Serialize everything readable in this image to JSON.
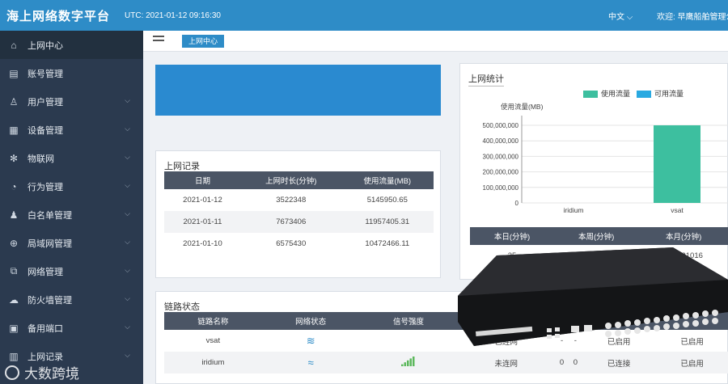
{
  "header": {
    "title": "海上网络数字平台",
    "clock": "UTC: 2021-01-12 09:16:30",
    "lang": "中文",
    "user": "欢迎: 早鹰船舶管理公"
  },
  "sidebar": {
    "items": [
      {
        "label": "上网中心",
        "icon": "home-icon",
        "active": true,
        "chevron": false
      },
      {
        "label": "账号管理",
        "icon": "id-card-icon",
        "chevron": false
      },
      {
        "label": "用户管理",
        "icon": "user-icon",
        "chevron": true
      },
      {
        "label": "设备管理",
        "icon": "device-icon",
        "chevron": true
      },
      {
        "label": "物联网",
        "icon": "iot-icon",
        "chevron": true
      },
      {
        "label": "行为管理",
        "icon": "gauge-icon",
        "chevron": true
      },
      {
        "label": "白名单管理",
        "icon": "whitelist-icon",
        "chevron": true
      },
      {
        "label": "局域网管理",
        "icon": "globe-icon",
        "chevron": true
      },
      {
        "label": "网络管理",
        "icon": "network-icon",
        "chevron": true
      },
      {
        "label": "防火墙管理",
        "icon": "cloud-icon",
        "chevron": true
      },
      {
        "label": "备用端口",
        "icon": "port-icon",
        "chevron": true
      },
      {
        "label": "上网记录",
        "icon": "record-icon",
        "chevron": true
      }
    ]
  },
  "tabs": {
    "active": "上网中心"
  },
  "records": {
    "title": "上网记录",
    "columns": [
      "日期",
      "上网时长(分钟)",
      "使用流量(MB)"
    ],
    "rows": [
      [
        "2021-01-12",
        "3522348",
        "5145950.65"
      ],
      [
        "2021-01-11",
        "7673406",
        "11957405.31"
      ],
      [
        "2021-01-10",
        "6575430",
        "10472466.11"
      ]
    ]
  },
  "traffic": {
    "title": "上网统计",
    "legend": [
      {
        "name": "使用流量",
        "color": "#3dbf9f"
      },
      {
        "name": "可用流量",
        "color": "#29a9e1"
      }
    ],
    "stats_columns": [
      "本日(分钟)",
      "本周(分钟)",
      "本月(分钟)"
    ],
    "stats_values": [
      "35",
      "",
      "338431016"
    ]
  },
  "chart_data": {
    "type": "bar",
    "ylabel": "使用流量(MB)",
    "categories": [
      "iridium",
      "vsat"
    ],
    "series": [
      {
        "name": "使用流量",
        "values": [
          0,
          500000000
        ]
      },
      {
        "name": "可用流量",
        "values": [
          0,
          0
        ]
      }
    ],
    "ylim": [
      0,
      500000000
    ],
    "yticks": [
      "500,000,000",
      "400,000,000",
      "300,000,000",
      "200,000,000",
      "100,000,000",
      "0"
    ],
    "xticklabels": [
      "iridium",
      "vsat"
    ]
  },
  "link": {
    "title": "链路状态",
    "columns": [
      "链路名称",
      "网络状态",
      "信号强度",
      "连网状态"
    ],
    "extra_columns": [
      "",
      "",
      "",
      "",
      ""
    ],
    "rows": [
      {
        "name": "vsat",
        "status_icon": "wifi-icon",
        "signal": "",
        "net": "已连网",
        "c5": "-",
        "c6": "-",
        "c7": "已启用",
        "c8": "已启用"
      },
      {
        "name": "iridium",
        "status_icon": "wifi-off-icon",
        "signal": "signal-bars",
        "net": "未连网",
        "c5": "0",
        "c6": "0",
        "c7": "已连接",
        "c8": "已启用"
      }
    ]
  },
  "watermark": "大数跨境",
  "colors": {
    "topbar": "#2e8cc7",
    "sidebar": "#2b3a4f",
    "accent_bar": "#3dbf9f",
    "tab": "#2e8cc7"
  }
}
